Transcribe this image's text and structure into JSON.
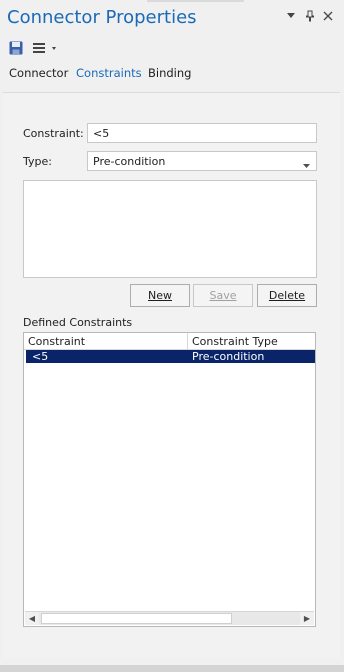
{
  "window": {
    "title": "Connector Properties",
    "buttons": {
      "dropdown_icon": "chevron-down-icon",
      "pin_icon": "pin-icon",
      "close_icon": "close-icon"
    }
  },
  "toolbar": {
    "save_icon": "save-disk-icon",
    "menu_icon": "hamburger-menu-icon"
  },
  "tabs": [
    {
      "label": "Connector",
      "active": false
    },
    {
      "label": "Constraints",
      "active": true
    },
    {
      "label": "Binding",
      "active": false
    }
  ],
  "form": {
    "constraint_label": "Constraint:",
    "constraint_value": "<5",
    "type_label": "Type:",
    "type_value": "Pre-condition",
    "notes_value": ""
  },
  "buttons": {
    "new": "New",
    "save": "Save",
    "delete": "Delete"
  },
  "list": {
    "label": "Defined Constraints",
    "columns": [
      "Constraint",
      "Constraint Type"
    ],
    "rows": [
      {
        "constraint": "<5",
        "type": "Pre-condition",
        "selected": true
      }
    ]
  },
  "colors": {
    "accent": "#1a6ab8",
    "selection": "#0a246a"
  }
}
